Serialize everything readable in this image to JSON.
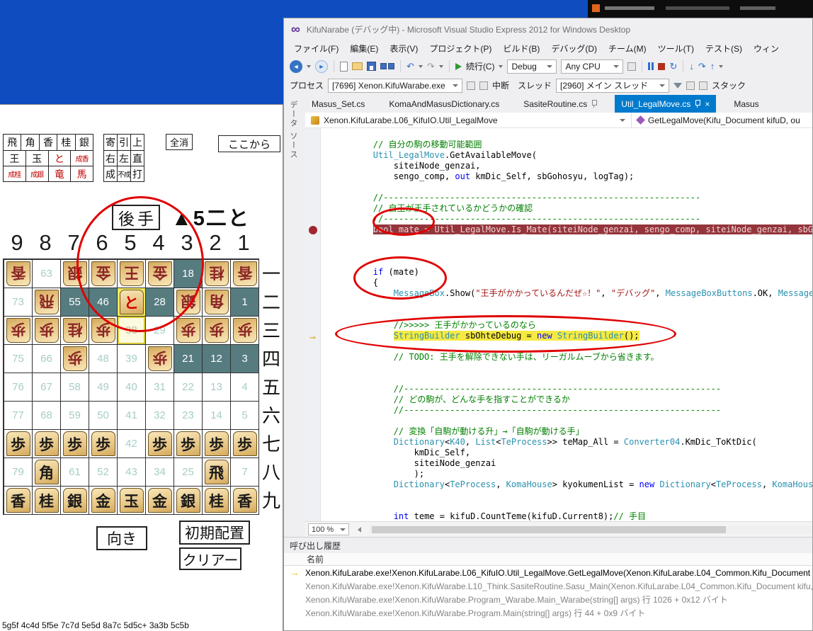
{
  "colors": {
    "accent_blue": "#007acc",
    "breakpoint_line_bg": "#94353c",
    "current_statement_bg": "#f5e942",
    "annotation_red": "#e00000",
    "desktop_blue": "#0f4cc0",
    "comment_green": "#008000",
    "keyword_blue": "#0000ff",
    "type_teal": "#2b91af",
    "string_red": "#a31515",
    "dark_square": "#567c80"
  },
  "shogi": {
    "palette_pieces": [
      [
        {
          "t": "飛"
        },
        {
          "t": "角"
        },
        {
          "t": "香"
        },
        {
          "t": "桂"
        },
        {
          "t": "銀"
        }
      ],
      [
        {
          "t": "王"
        },
        {
          "t": "玉"
        },
        {
          "t": "と",
          "r": 1
        },
        {
          "t": "成香",
          "r": 1
        }
      ],
      [
        {
          "t": "成桂",
          "r": 1
        },
        {
          "t": "成銀",
          "r": 1
        },
        {
          "t": "竜",
          "r": 1
        },
        {
          "t": "馬",
          "r": 1
        }
      ]
    ],
    "palette_actions": [
      [
        {
          "t": "寄"
        },
        {
          "t": "引"
        },
        {
          "t": "上"
        }
      ],
      [
        {
          "t": "右"
        },
        {
          "t": "左"
        },
        {
          "t": "直"
        }
      ],
      [
        {
          "t": "成"
        },
        {
          "t": "不成"
        },
        {
          "t": "打"
        }
      ]
    ],
    "clear_all": "全消",
    "from_here": "ここから",
    "turn": "後手",
    "move": "▲5二と",
    "cols": [
      "9",
      "8",
      "7",
      "6",
      "5",
      "4",
      "3",
      "2",
      "1"
    ],
    "rows": [
      "一",
      "二",
      "三",
      "四",
      "五",
      "六",
      "七",
      "八",
      "九"
    ],
    "board": [
      [
        {
          "p": "香",
          "s": "g"
        },
        {
          "n": 63
        },
        {
          "p": "銀",
          "s": "g"
        },
        {
          "p": "金",
          "s": "g"
        },
        {
          "p": "王",
          "s": "g"
        },
        {
          "p": "金",
          "s": "g"
        },
        {
          "n": 18,
          "d": 1
        },
        {
          "p": "桂",
          "s": "g"
        },
        {
          "p": "香",
          "s": "g"
        }
      ],
      [
        {
          "n": 73
        },
        {
          "p": "飛",
          "s": "g"
        },
        {
          "n": 55,
          "d": 1
        },
        {
          "n": 46,
          "d": 1
        },
        {
          "p": "と",
          "s": "s",
          "pr": 1,
          "h": 1
        },
        {
          "n": 28,
          "d": 1
        },
        {
          "p": "銀",
          "s": "g"
        },
        {
          "p": "角",
          "s": "g"
        },
        {
          "n": 1,
          "d": 1
        }
      ],
      [
        {
          "p": "歩",
          "s": "g"
        },
        {
          "p": "歩",
          "s": "g"
        },
        {
          "p": "桂",
          "s": "g"
        },
        {
          "p": "歩",
          "s": "g"
        },
        {
          "n": 38,
          "h2": 1
        },
        {
          "n": 29
        },
        {
          "p": "歩",
          "s": "g"
        },
        {
          "p": "歩",
          "s": "g"
        },
        {
          "p": "歩",
          "s": "g"
        }
      ],
      [
        {
          "n": 75
        },
        {
          "n": 66
        },
        {
          "p": "歩",
          "s": "g"
        },
        {
          "n": 48
        },
        {
          "n": 39
        },
        {
          "p": "歩",
          "s": "g"
        },
        {
          "n": 21,
          "d": 1
        },
        {
          "n": 12,
          "d": 1
        },
        {
          "n": 3,
          "d": 1
        }
      ],
      [
        {
          "n": 76
        },
        {
          "n": 67
        },
        {
          "n": 58
        },
        {
          "n": 49
        },
        {
          "n": 40
        },
        {
          "n": 31
        },
        {
          "n": 22
        },
        {
          "n": 13
        },
        {
          "n": 4
        }
      ],
      [
        {
          "n": 77
        },
        {
          "n": 68
        },
        {
          "n": 59
        },
        {
          "n": 50
        },
        {
          "n": 41
        },
        {
          "n": 32
        },
        {
          "n": 23
        },
        {
          "n": 14
        },
        {
          "n": 5
        }
      ],
      [
        {
          "p": "歩",
          "s": "s"
        },
        {
          "p": "歩",
          "s": "s"
        },
        {
          "p": "歩",
          "s": "s"
        },
        {
          "p": "歩",
          "s": "s"
        },
        {
          "n": 42
        },
        {
          "p": "歩",
          "s": "s"
        },
        {
          "p": "歩",
          "s": "s"
        },
        {
          "p": "歩",
          "s": "s"
        },
        {
          "p": "歩",
          "s": "s"
        }
      ],
      [
        {
          "n": 79
        },
        {
          "p": "角",
          "s": "s"
        },
        {
          "n": 61
        },
        {
          "n": 52
        },
        {
          "n": 43
        },
        {
          "n": 34
        },
        {
          "n": 25
        },
        {
          "p": "飛",
          "s": "s"
        },
        {
          "n": 7
        }
      ],
      [
        {
          "p": "香",
          "s": "s"
        },
        {
          "p": "桂",
          "s": "s"
        },
        {
          "p": "銀",
          "s": "s"
        },
        {
          "p": "金",
          "s": "s"
        },
        {
          "p": "玉",
          "s": "s"
        },
        {
          "p": "金",
          "s": "s"
        },
        {
          "p": "銀",
          "s": "s"
        },
        {
          "p": "桂",
          "s": "s"
        },
        {
          "p": "香",
          "s": "s"
        }
      ]
    ],
    "button_direction": "向き",
    "button_initial": "初期配置",
    "button_clear": "クリアー",
    "kifu": "5g5f 4c4d 5f5e 7c7d 5e5d 8a7c 5d5c+ 3a3b 5c5b"
  },
  "vs": {
    "title": "KifuNarabe (デバッグ中) - Microsoft Visual Studio Express 2012 for Windows Desktop",
    "menus": [
      "ファイル(F)",
      "編集(E)",
      "表示(V)",
      "プロジェクト(P)",
      "ビルド(B)",
      "デバッグ(D)",
      "チーム(M)",
      "ツール(T)",
      "テスト(S)",
      "ウィン"
    ],
    "toolbar": {
      "continue_label": "続行(C)",
      "config": "Debug",
      "platform": "Any CPU"
    },
    "debug_location": {
      "process_label": "プロセス",
      "process": "[7696] Xenon.KifuWarabe.exe",
      "break_label": "中断",
      "thread_label": "スレッド",
      "thread": "[2960] メイン スレッド",
      "stack_label": "スタック"
    },
    "side_tab": "データ ソース",
    "tabs": [
      {
        "label": "Masus_Set.cs"
      },
      {
        "label": "KomaAndMasusDictionary.cs"
      },
      {
        "label": "SasiteRoutine.cs",
        "pinned": true
      },
      {
        "label": "Util_LegalMove.cs",
        "active": true
      },
      {
        "label": "Masus"
      }
    ],
    "breadcrumb": {
      "scope": "Xenon.KifuLarabe.L06_KifuIO.Util_LegalMove",
      "member": "GetLegalMove(Kifu_Document kifuD, ou"
    },
    "zoom": "100 %",
    "code": {
      "breakpoint_line": 9,
      "current_line": 19,
      "lines": [
        {
          "seg": [
            [
              "        // 自分の駒の移動可能範囲",
              "g"
            ]
          ]
        },
        {
          "seg": [
            [
              "        ",
              "p"
            ],
            [
              "Util_LegalMove",
              "t"
            ],
            [
              ".GetAvailableMove(",
              "p"
            ]
          ]
        },
        {
          "seg": [
            [
              "            siteiNode_genzai,",
              "p"
            ]
          ]
        },
        {
          "seg": [
            [
              "            sengo_comp, ",
              "p"
            ],
            [
              "out",
              "k"
            ],
            [
              " kmDic_Self, sbGohosyu, logTag);",
              "p"
            ]
          ]
        },
        {},
        {
          "seg": [
            [
              "        //--------------------------------------------------------------",
              "g"
            ]
          ]
        },
        {
          "seg": [
            [
              "        // 自玉が王手されているかどうかの確認",
              "g"
            ]
          ]
        },
        {
          "seg": [
            [
              "        //--------------------------------------------------------------",
              "g"
            ]
          ]
        },
        {
          "hl": "bp",
          "seg": [
            [
              "        ",
              "p"
            ],
            [
              "bool mate = Util_LegalMove.Is_Mate(siteiNode_genzai, sengo_comp, siteiNode_genzai, sbGohosyu, logTag);",
              "m"
            ]
          ]
        },
        {},
        {},
        {},
        {
          "seg": [
            [
              "        ",
              "p"
            ],
            [
              "if",
              "k"
            ],
            [
              " (mate)",
              "p"
            ]
          ]
        },
        {
          "seg": [
            [
              "        {",
              "p"
            ]
          ]
        },
        {
          "seg": [
            [
              "            ",
              "p"
            ],
            [
              "MessageBox",
              "t"
            ],
            [
              ".Show(",
              "p"
            ],
            [
              "\"王手がかかっているんだぜ☆！\"",
              "s"
            ],
            [
              ", ",
              "p"
            ],
            [
              "\"デバッグ\"",
              "s"
            ],
            [
              ", ",
              "p"
            ],
            [
              "MessageBoxButtons",
              "t"
            ],
            [
              ".OK, ",
              "p"
            ],
            [
              "MessageBoxIcon",
              "t"
            ]
          ]
        },
        {},
        {},
        {
          "seg": [
            [
              "            //>>>>> 王手がかかっているのなら",
              "g"
            ]
          ]
        },
        {
          "hl": "cur",
          "seg": [
            [
              "            ",
              "p"
            ],
            [
              "StringBuilder",
              "t"
            ],
            [
              " sbOhteDebug = ",
              "p"
            ],
            [
              "new",
              "k"
            ],
            [
              " ",
              "p"
            ],
            [
              "StringBuilder",
              "t"
            ],
            [
              "();",
              "p"
            ]
          ]
        },
        {},
        {
          "seg": [
            [
              "            // TODO: 王手を解除できない手は、リーガルムーブから省きます。",
              "g"
            ]
          ]
        },
        {},
        {},
        {
          "seg": [
            [
              "            //--------------------------------------------------------------",
              "g"
            ]
          ]
        },
        {
          "seg": [
            [
              "            // どの駒が、どんな手を指すことができるか",
              "g"
            ]
          ]
        },
        {
          "seg": [
            [
              "            //--------------------------------------------------------------",
              "g"
            ]
          ]
        },
        {},
        {
          "seg": [
            [
              "            // 変換「自駒が動ける升」→「自駒が動ける手」",
              "g"
            ]
          ]
        },
        {
          "seg": [
            [
              "            ",
              "p"
            ],
            [
              "Dictionary",
              "t"
            ],
            [
              "<",
              "p"
            ],
            [
              "K40",
              "t"
            ],
            [
              ", ",
              "p"
            ],
            [
              "List",
              "t"
            ],
            [
              "<",
              "p"
            ],
            [
              "TeProcess",
              "t"
            ],
            [
              ">> teMap_All = ",
              "p"
            ],
            [
              "Converter04",
              "t"
            ],
            [
              ".KmDic_ToKtDic(",
              "p"
            ]
          ]
        },
        {
          "seg": [
            [
              "                kmDic_Self,",
              "p"
            ]
          ]
        },
        {
          "seg": [
            [
              "                siteiNode_genzai",
              "p"
            ]
          ]
        },
        {
          "seg": [
            [
              "                );",
              "p"
            ]
          ]
        },
        {
          "seg": [
            [
              "            ",
              "p"
            ],
            [
              "Dictionary",
              "t"
            ],
            [
              "<",
              "p"
            ],
            [
              "TeProcess",
              "t"
            ],
            [
              ", ",
              "p"
            ],
            [
              "KomaHouse",
              "t"
            ],
            [
              "> kyokumenList = ",
              "p"
            ],
            [
              "new",
              "k"
            ],
            [
              " ",
              "p"
            ],
            [
              "Dictionary",
              "t"
            ],
            [
              "<",
              "p"
            ],
            [
              "TeProcess",
              "t"
            ],
            [
              ", ",
              "p"
            ],
            [
              "KomaHouse",
              "t"
            ],
            [
              ">();",
              "p"
            ]
          ]
        },
        {},
        {},
        {
          "seg": [
            [
              "            ",
              "p"
            ],
            [
              "int",
              "k"
            ],
            [
              " teme = kifuD.CountTeme(kifuD.Current8);",
              "p"
            ],
            [
              "// 手目",
              "g"
            ]
          ]
        }
      ]
    },
    "callstack": {
      "title": "呼び出し履歴",
      "name_column": "名前",
      "frames": [
        {
          "current": true,
          "text": "Xenon.KifuLarabe.exe!Xenon.KifuLarabe.L06_KifuIO.Util_LegalMove.GetLegalMove(Xenon.KifuLarabe.L04_Common.Kifu_Document "
        },
        {
          "dim": true,
          "text": "Xenon.KifuWarabe.exe!Xenon.KifuWarabe.L10_Think.SasiteRoutine.Sasu_Main(Xenon.KifuLarabe.L04_Common.Kifu_Document kifu,"
        },
        {
          "dim": true,
          "text": "Xenon.KifuWarabe.exe!Xenon.KifuWarabe.Program_Warabe.Main_Warabe(string[] args) 行 1026 + 0x12 バイト"
        },
        {
          "dim": true,
          "text": "Xenon.KifuWarabe.exe!Xenon.KifuWarabe.Program.Main(string[] args) 行 44 + 0x9 バイト"
        }
      ]
    }
  }
}
